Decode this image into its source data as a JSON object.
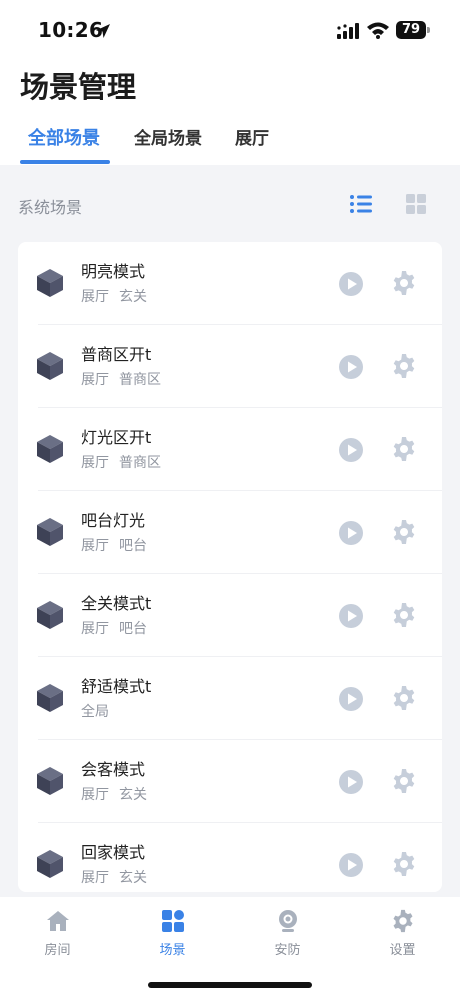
{
  "status_bar": {
    "time": "10:26",
    "battery": "79"
  },
  "page": {
    "title": "场景管理"
  },
  "tabs": [
    {
      "label": "全部场景",
      "active": true
    },
    {
      "label": "全局场景",
      "active": false
    },
    {
      "label": "展厅",
      "active": false
    }
  ],
  "section": {
    "title": "系统场景"
  },
  "scenes": [
    {
      "name": "明亮模式",
      "tags": [
        "展厅",
        "玄关"
      ]
    },
    {
      "name": "普商区开t",
      "tags": [
        "展厅",
        "普商区"
      ]
    },
    {
      "name": "灯光区开t",
      "tags": [
        "展厅",
        "普商区"
      ]
    },
    {
      "name": "吧台灯光",
      "tags": [
        "展厅",
        "吧台"
      ]
    },
    {
      "name": "全关模式t",
      "tags": [
        "展厅",
        "吧台"
      ]
    },
    {
      "name": "舒适模式t",
      "tags": [
        "全局"
      ]
    },
    {
      "name": "会客模式",
      "tags": [
        "展厅",
        "玄关"
      ]
    },
    {
      "name": "回家模式",
      "tags": [
        "展厅",
        "玄关"
      ]
    }
  ],
  "bottom_nav": [
    {
      "label": "房间",
      "icon": "house-icon",
      "active": false
    },
    {
      "label": "场景",
      "icon": "scene-grid-icon",
      "active": true
    },
    {
      "label": "安防",
      "icon": "camera-icon",
      "active": false
    },
    {
      "label": "设置",
      "icon": "gear-icon",
      "active": false
    }
  ],
  "colors": {
    "accent": "#3a82e6",
    "icon_muted": "#c2cad6",
    "cube": "#4a4e63"
  }
}
